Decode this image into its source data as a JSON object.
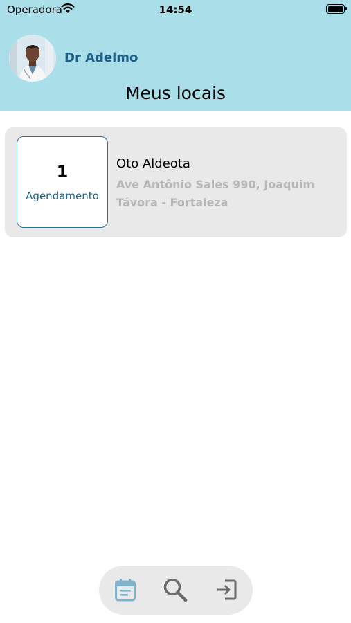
{
  "status_bar": {
    "carrier": "Operadora",
    "time": "14:54"
  },
  "header": {
    "doctor_name": "Dr Adelmo",
    "title": "Meus locais"
  },
  "locations": [
    {
      "count": "1",
      "count_label": "Agendamento",
      "name": "Oto Aldeota",
      "address": "Ave Antônio Sales 990, Joaquim Távora - Fortaleza"
    }
  ],
  "bottom_nav": {
    "items": [
      {
        "icon": "calendar-icon",
        "active": true
      },
      {
        "icon": "search-icon",
        "active": false
      },
      {
        "icon": "logout-icon",
        "active": false
      }
    ]
  },
  "colors": {
    "header_bg": "#aadfe9",
    "accent": "#1d5f86",
    "active_icon": "#7fb3cc",
    "card_bg": "#e9e9e9",
    "muted_text": "#b7b7b7"
  }
}
